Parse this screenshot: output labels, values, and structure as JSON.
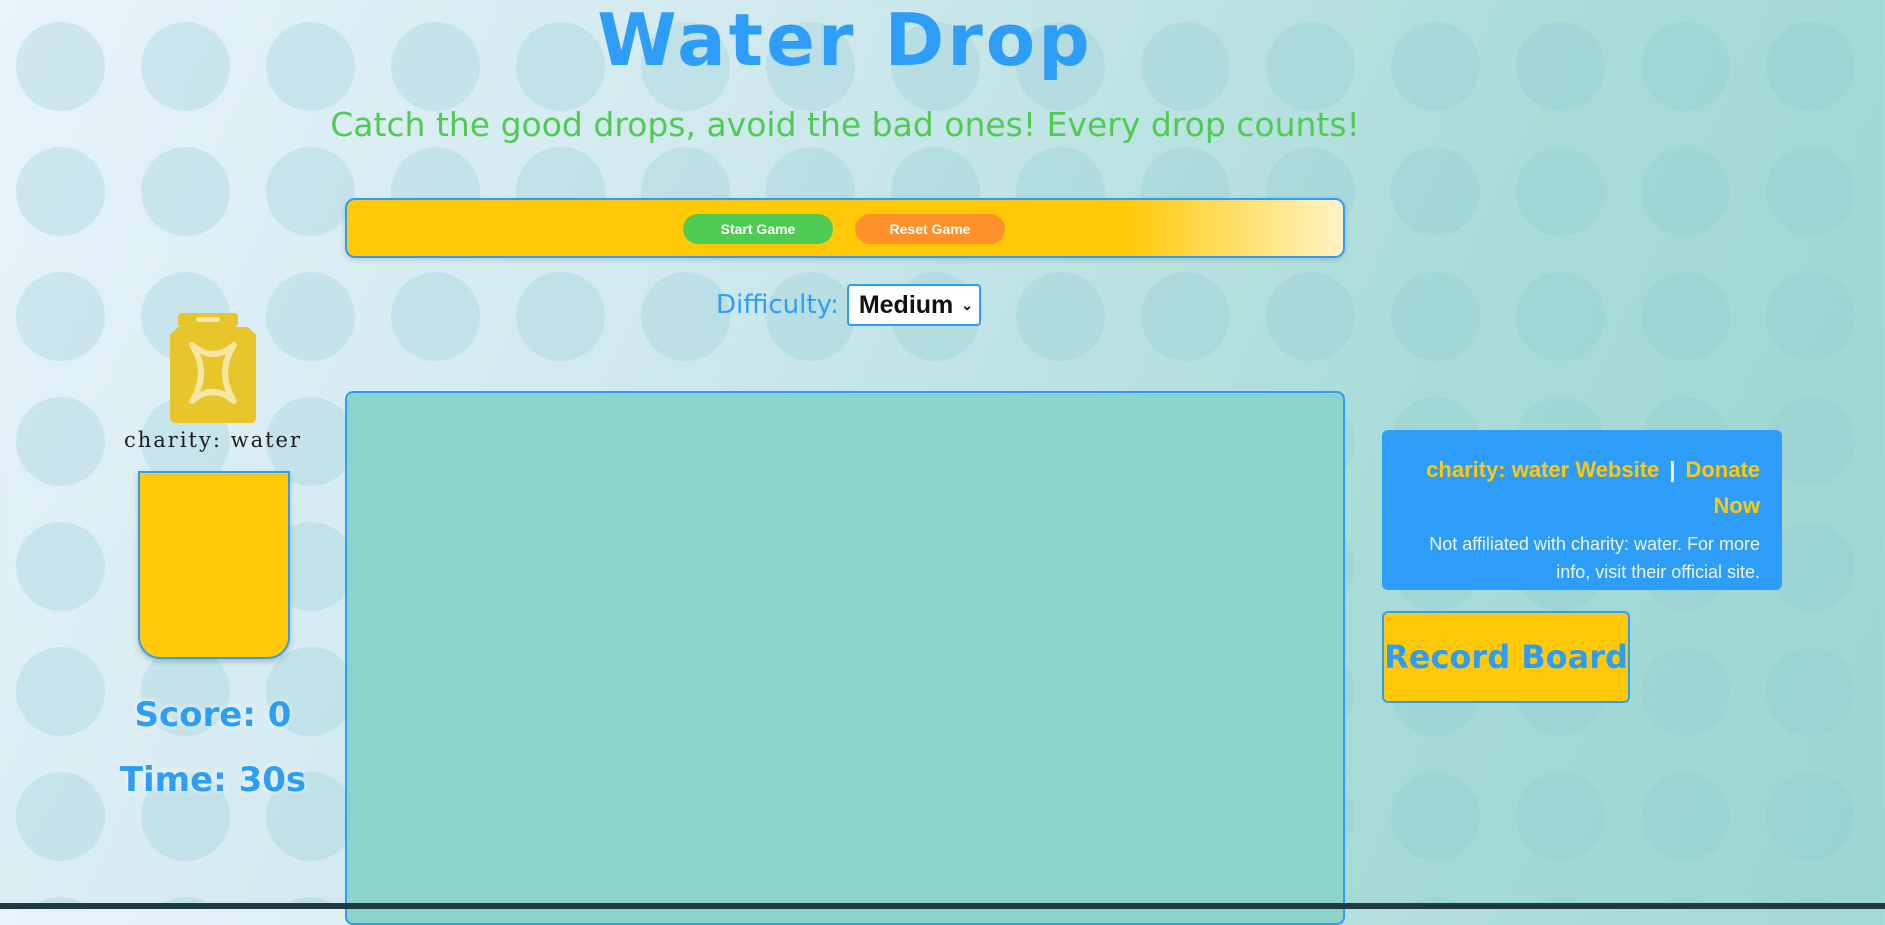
{
  "header": {
    "title": "Water Drop",
    "subtitle": "Catch the good drops, avoid the bad ones! Every drop counts!"
  },
  "controls": {
    "start_label": "Start Game",
    "reset_label": "Reset Game"
  },
  "difficulty": {
    "label": "Difficulty:",
    "selected": "Medium"
  },
  "branding": {
    "logo_text": "charity: water",
    "logo_icon": "jerrycan-icon"
  },
  "stats": {
    "score_text": "Score: 0",
    "time_text": "Time: 30s"
  },
  "info": {
    "website_link": "charity: water Website",
    "separator": "|",
    "donate_link": "Donate Now",
    "note": "Not affiliated with charity: water. For more info, visit their official site."
  },
  "record_board": {
    "label": "Record Board"
  },
  "colors": {
    "primary_blue": "#2e9df7",
    "yellow": "#ffc907",
    "green": "#4fcb53",
    "orange": "#ff902a",
    "game_area": "#8cd3cc"
  }
}
